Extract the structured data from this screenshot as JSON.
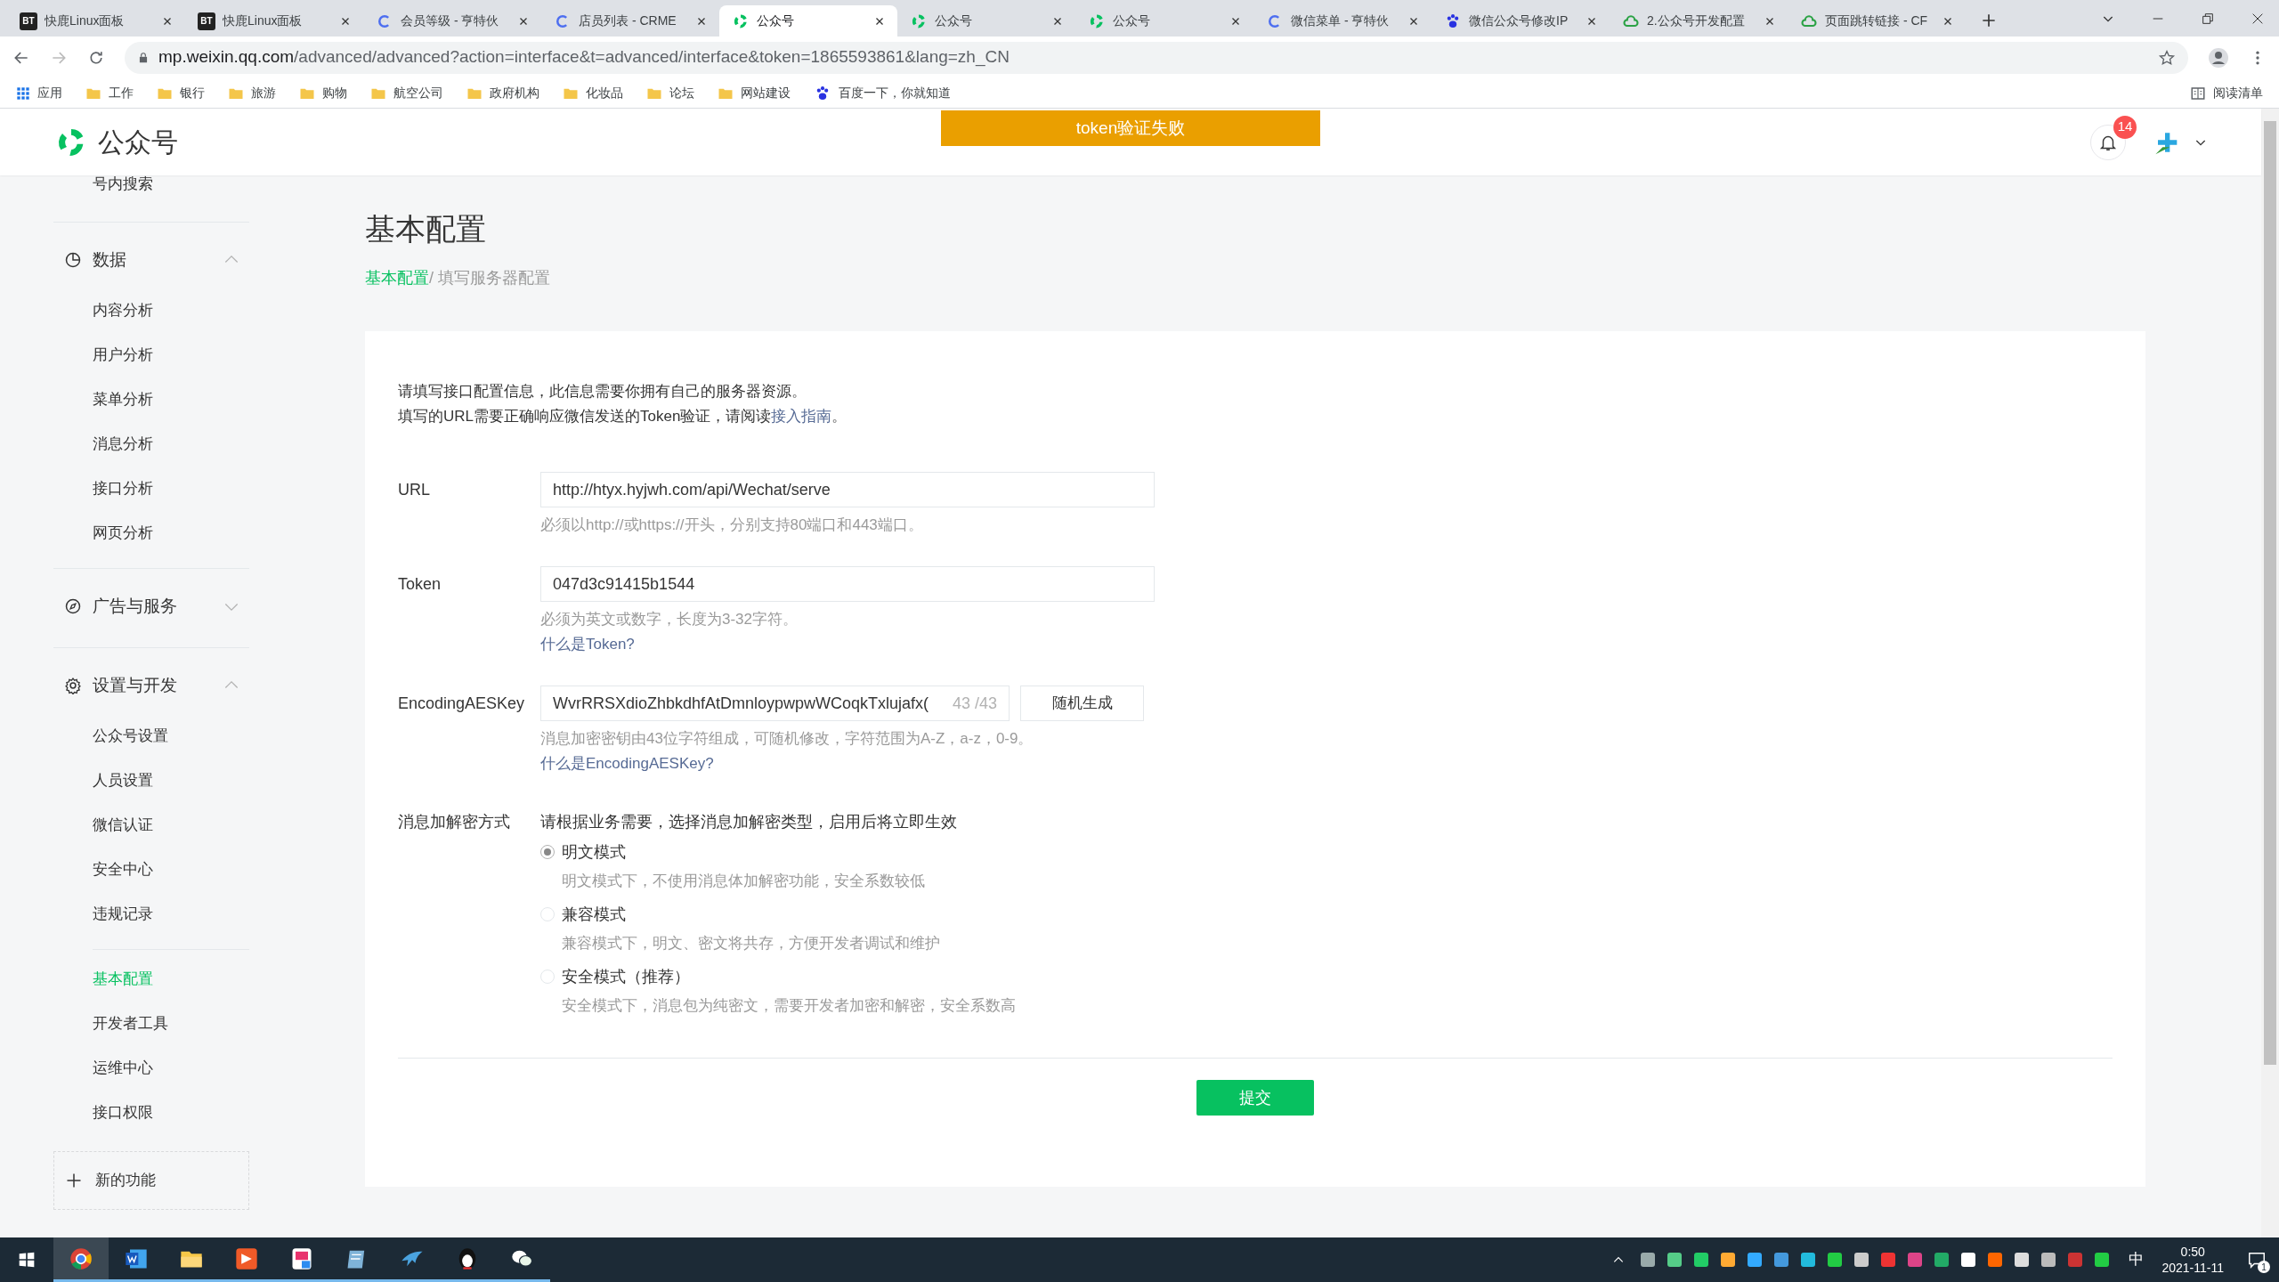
{
  "browser": {
    "tabs": [
      {
        "kind": "bt",
        "icon_text": "BT",
        "title": "快鹿Linux面板",
        "selected": false
      },
      {
        "kind": "bt",
        "icon_text": "BT",
        "title": "快鹿Linux面板",
        "selected": false
      },
      {
        "kind": "c",
        "title": "会员等级 - 亨特伙",
        "selected": false
      },
      {
        "kind": "c",
        "title": "店员列表 - CRME",
        "selected": false
      },
      {
        "kind": "mp",
        "title": "公众号",
        "selected": true
      },
      {
        "kind": "mp",
        "title": "公众号",
        "selected": false
      },
      {
        "kind": "mp",
        "title": "公众号",
        "selected": false
      },
      {
        "kind": "c",
        "title": "微信菜单 - 亨特伙",
        "selected": false
      },
      {
        "kind": "paw",
        "title": "微信公众号修改IP",
        "selected": false
      },
      {
        "kind": "cloud",
        "title": "2.公众号开发配置",
        "selected": false
      },
      {
        "kind": "cloud",
        "title": "页面跳转链接 - CF",
        "selected": false
      }
    ],
    "url_host": "mp.weixin.qq.com",
    "url_path": "/advanced/advanced?action=interface&t=advanced/interface&token=1865593861&lang=zh_CN",
    "apps": "应用",
    "bookmarks": [
      {
        "kind": "folder",
        "label": "工作"
      },
      {
        "kind": "folder",
        "label": "银行"
      },
      {
        "kind": "folder",
        "label": "旅游"
      },
      {
        "kind": "folder",
        "label": "购物"
      },
      {
        "kind": "folder",
        "label": "航空公司"
      },
      {
        "kind": "folder",
        "label": "政府机构"
      },
      {
        "kind": "folder",
        "label": "化妆品"
      },
      {
        "kind": "folder",
        "label": "论坛"
      },
      {
        "kind": "folder",
        "label": "网站建设"
      },
      {
        "kind": "paw",
        "label": "百度一下，你就知道"
      }
    ],
    "reading_list": "阅读清单"
  },
  "header": {
    "brand": "公众号",
    "alert": "token验证失败",
    "notification_count": "14"
  },
  "sidebar": {
    "top_item": "号内搜索",
    "sections": [
      {
        "title": "数据",
        "kind": "chart",
        "expanded": true,
        "items": [
          {
            "label": "内容分析",
            "selected": false
          },
          {
            "label": "用户分析",
            "selected": false
          },
          {
            "label": "菜单分析",
            "selected": false
          },
          {
            "label": "消息分析",
            "selected": false
          },
          {
            "label": "接口分析",
            "selected": false
          },
          {
            "label": "网页分析",
            "selected": false
          }
        ]
      },
      {
        "title": "广告与服务",
        "kind": "compass",
        "expanded": false
      },
      {
        "title": "设置与开发",
        "kind": "gear",
        "expanded": true,
        "items": [
          {
            "label": "公众号设置",
            "selected": false
          },
          {
            "label": "人员设置",
            "selected": false
          },
          {
            "label": "微信认证",
            "selected": false
          },
          {
            "label": "安全中心",
            "selected": false
          },
          {
            "label": "违规记录",
            "selected": false
          }
        ]
      },
      {
        "items": [
          {
            "label": "基本配置",
            "selected": true
          },
          {
            "label": "开发者工具",
            "selected": false
          },
          {
            "label": "运维中心",
            "selected": false
          },
          {
            "label": "接口权限",
            "selected": false
          }
        ]
      }
    ],
    "new_feature": "新的功能"
  },
  "main": {
    "title": "基本配置",
    "breadcrumb": [
      {
        "label": "基本配置",
        "selected": false
      },
      {
        "label": "/ 填写服务器配置",
        "selected": true
      }
    ],
    "intro": "请填写接口配置信息，此信息需要你拥有自己的服务器资源。",
    "intro2": {
      "text": "填写的URL需要正确响应微信发送的Token验证，请阅读",
      "link": "接入指南",
      "after": "。"
    },
    "fields": [
      {
        "label": "URL",
        "value": "http://htyx.hyjwh.com/api/Wechat/serve",
        "hint": "必须以http://或https://开头，分别支持80端口和443端口。"
      },
      {
        "label": "Token",
        "value": "047d3c91415b1544",
        "hint": "必须为英文或数字，长度为3-32字符。",
        "link": "什么是Token?"
      },
      {
        "label": "EncodingAESKey",
        "value": "WvrRRSXdioZhbkdhfAtDmnloypwpwWCoqkTxlujafx(",
        "counter": "43 /43",
        "button": "随机生成",
        "hint": "消息加密密钥由43位字符组成，可随机修改，字符范围为A-Z，a-z，0-9。",
        "link": "什么是EncodingAESKey?"
      }
    ],
    "encryption": {
      "label": "消息加解密方式",
      "description": "请根据业务需要，选择消息加解密类型，启用后将立即生效",
      "options": [
        {
          "label": "明文模式",
          "hint": "明文模式下，不使用消息体加解密功能，安全系数较低",
          "selected": true
        },
        {
          "label": "兼容模式",
          "hint": "兼容模式下，明文、密文将共存，方便开发者调试和维护",
          "selected": false
        },
        {
          "label": "安全模式（推荐）",
          "hint": "安全模式下，消息包为纯密文，需要开发者加密和解密，安全系数高",
          "selected": false
        }
      ]
    },
    "submit": "提交"
  },
  "taskbar": {
    "apps": [
      {
        "kind": "chrome",
        "selected": true
      },
      {
        "kind": "word",
        "selected": false
      },
      {
        "kind": "explorer",
        "selected": false
      },
      {
        "kind": "orange",
        "selected": false
      },
      {
        "kind": "pink",
        "selected": false
      },
      {
        "kind": "notebook",
        "selected": false
      },
      {
        "kind": "bird",
        "selected": false
      },
      {
        "kind": "penguin",
        "selected": false
      },
      {
        "kind": "wechat",
        "selected": false
      }
    ],
    "ime": "中",
    "time": "0:50",
    "date": "2021-11-11",
    "notifications": "1"
  }
}
